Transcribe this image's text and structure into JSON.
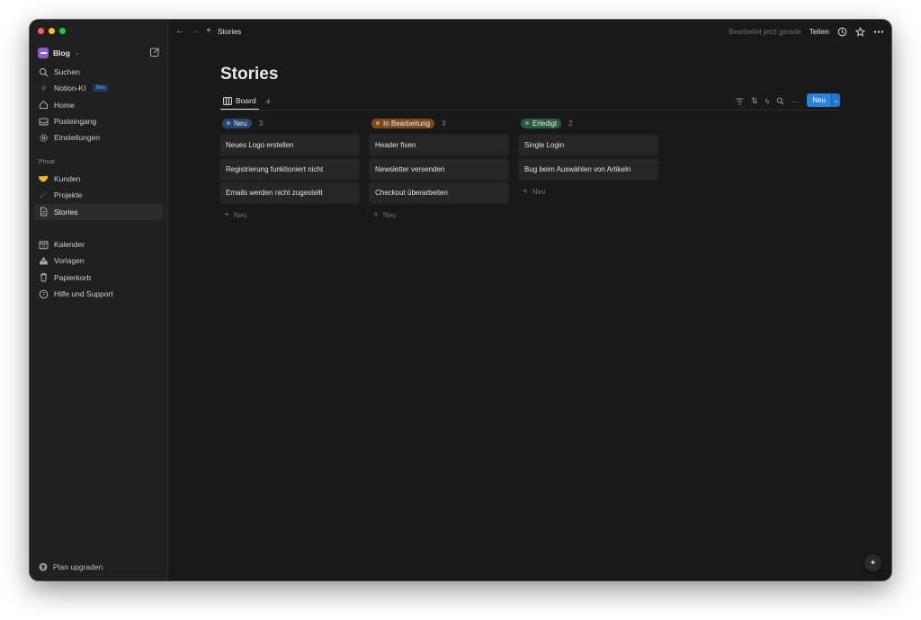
{
  "sidebar": {
    "workspace": {
      "name": "Blog",
      "color": "#8e5bd1"
    },
    "nav_top": [
      {
        "label": "Suchen",
        "icon": "search-icon"
      },
      {
        "label": "Notion-KI",
        "icon": "sparkle-icon",
        "badge": "Neu"
      },
      {
        "label": "Home",
        "icon": "home-icon"
      },
      {
        "label": "Posteingang",
        "icon": "inbox-icon"
      },
      {
        "label": "Einstellungen",
        "icon": "gear-icon"
      }
    ],
    "section_label": "Privat",
    "pages": [
      {
        "label": "Kunden",
        "icon": "handshake-emoji-icon"
      },
      {
        "label": "Projekte",
        "icon": "comet-emoji-icon"
      },
      {
        "label": "Stories",
        "icon": "page-icon"
      }
    ],
    "nav_bottom": [
      {
        "label": "Kalender",
        "icon": "calendar-icon"
      },
      {
        "label": "Vorlagen",
        "icon": "templates-icon"
      },
      {
        "label": "Papierkorb",
        "icon": "trash-icon"
      },
      {
        "label": "Hilfe und Support",
        "icon": "help-icon"
      }
    ],
    "upgrade": "Plan upgraden"
  },
  "topbar": {
    "title": "Stories",
    "edited": "Bearbeitet jetzt gerade",
    "share": "Teilen"
  },
  "page": {
    "title": "Stories",
    "view_tab": "Board",
    "new_button": "Neu"
  },
  "board": {
    "columns": [
      {
        "status": "Neu",
        "count": "3",
        "pill_bg": "#28456c",
        "dot": "#5b97e5",
        "cards": [
          "Neues Logo erstellen",
          "Registrierung funktioniert nicht",
          "Emails werden nicht zugestellt"
        ],
        "add_label": "Neu"
      },
      {
        "status": "In Bearbeitung",
        "count": "3",
        "pill_bg": "#7a4a1f",
        "dot": "#e0883a",
        "cards": [
          "Header fixen",
          "Newsletter versenden",
          "Checkout überarbeiten"
        ],
        "add_label": "Neu"
      },
      {
        "status": "Erledigt",
        "count": "2",
        "pill_bg": "#2b5a3e",
        "dot": "#4cae6b",
        "cards": [
          "Single Login",
          "Bug beim Auswählen von Artikeln"
        ],
        "add_label": "Neu"
      }
    ]
  }
}
